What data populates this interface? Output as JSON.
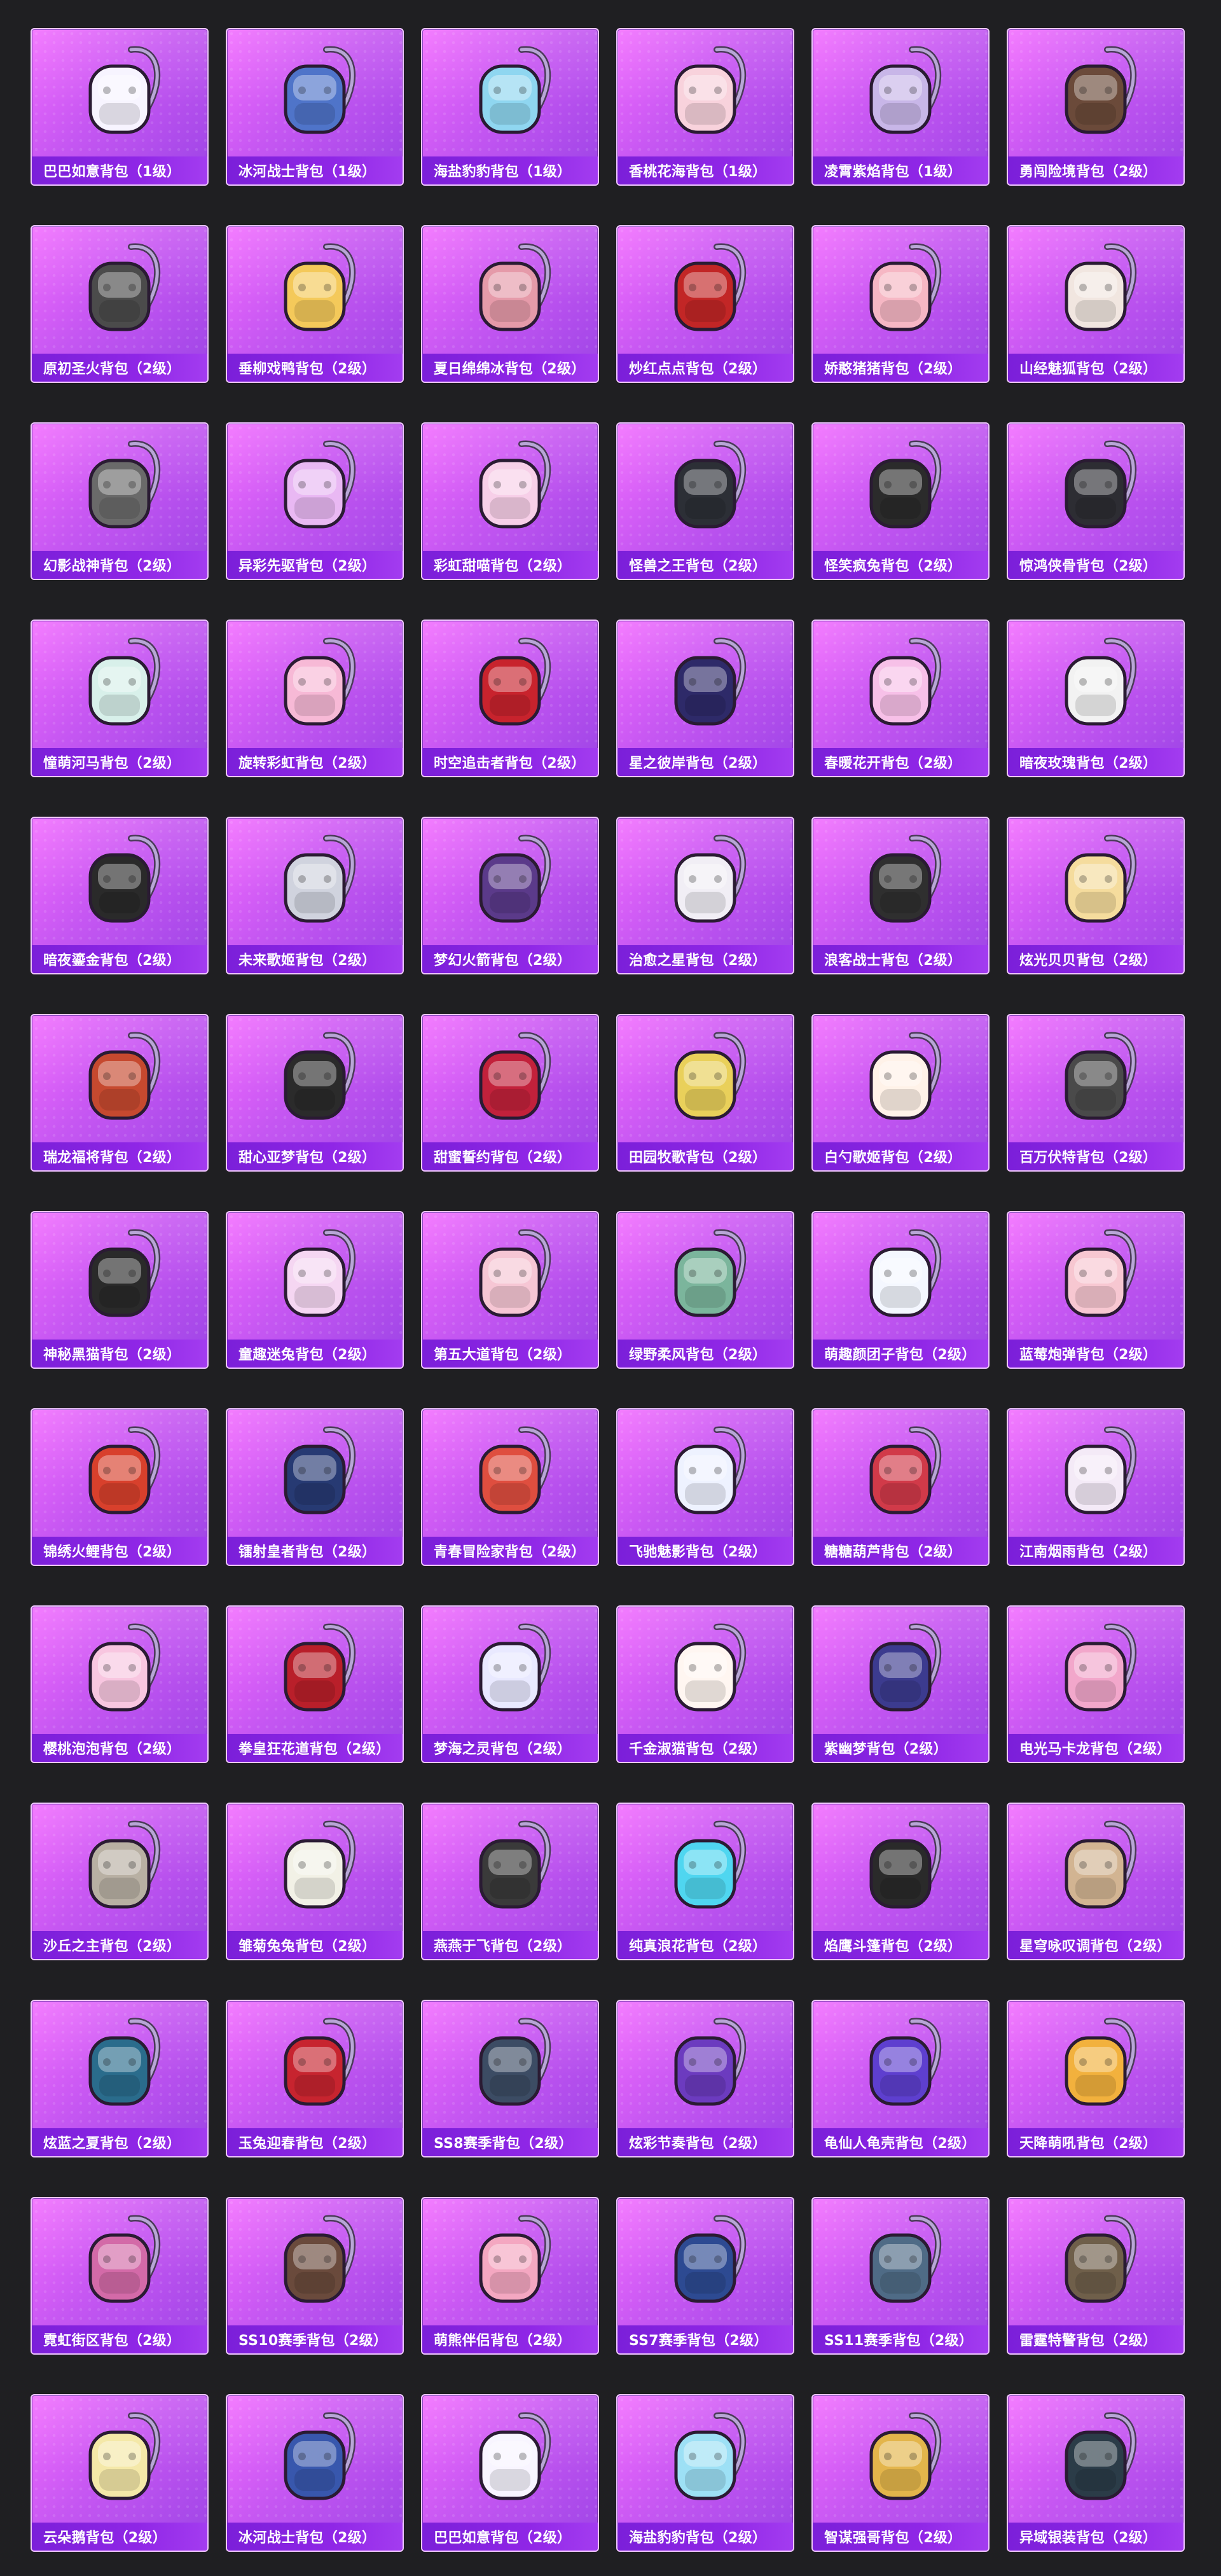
{
  "grid": {
    "items": [
      {
        "label": "巴巴如意背包（1级）",
        "icon": "backpack-icon",
        "color": "#f7f4ff"
      },
      {
        "label": "冰河战士背包（1级）",
        "icon": "backpack-icon",
        "color": "#4f74c9"
      },
      {
        "label": "海盐豹豹背包（1级）",
        "icon": "backpack-icon",
        "color": "#8fd6f0"
      },
      {
        "label": "香桃花海背包（1级）",
        "icon": "backpack-icon",
        "color": "#f8d2dc"
      },
      {
        "label": "凌霄紫焰背包（1级）",
        "icon": "backpack-icon",
        "color": "#c8b6e8"
      },
      {
        "label": "勇闯险境背包（2级）",
        "icon": "backpack-icon",
        "color": "#6b4a3a"
      },
      {
        "label": "原初圣火背包（2级）",
        "icon": "backpack-icon",
        "color": "#4b4b4b"
      },
      {
        "label": "垂柳戏鸭背包（2级）",
        "icon": "backpack-icon",
        "color": "#f4c95a"
      },
      {
        "label": "夏日绵绵冰背包（2级）",
        "icon": "backpack-icon",
        "color": "#e59aa9"
      },
      {
        "label": "炒红点点背包（2级）",
        "icon": "backpack-icon",
        "color": "#c22626"
      },
      {
        "label": "娇憨猪猪背包（2级）",
        "icon": "backpack-icon",
        "color": "#f6b7c4"
      },
      {
        "label": "山经魅狐背包（2级）",
        "icon": "backpack-icon",
        "color": "#f1e6e0"
      },
      {
        "label": "幻影战神背包（2级）",
        "icon": "backpack-icon",
        "color": "#6a6a6a"
      },
      {
        "label": "异彩先驱背包（2级）",
        "icon": "backpack-icon",
        "color": "#e9b8f3"
      },
      {
        "label": "彩虹甜喵背包（2级）",
        "icon": "backpack-icon",
        "color": "#f7cfe8"
      },
      {
        "label": "怪兽之王背包（2级）",
        "icon": "backpack-icon",
        "color": "#2c2f36"
      },
      {
        "label": "怪笑疯兔背包（2级）",
        "icon": "backpack-icon",
        "color": "#2b2b2b"
      },
      {
        "label": "惊鸿侠骨背包（2级）",
        "icon": "backpack-icon",
        "color": "#2d2d33"
      },
      {
        "label": "憧萌河马背包（2级）",
        "icon": "backpack-icon",
        "color": "#d8f0ea"
      },
      {
        "label": "旋转彩虹背包（2级）",
        "icon": "backpack-icon",
        "color": "#f7b9d6"
      },
      {
        "label": "时空追击者背包（2级）",
        "icon": "backpack-icon",
        "color": "#c8232d"
      },
      {
        "label": "星之彼岸背包（2级）",
        "icon": "backpack-icon",
        "color": "#2e2a69"
      },
      {
        "label": "春暖花开背包（2级）",
        "icon": "backpack-icon",
        "color": "#f7c0e8"
      },
      {
        "label": "暗夜玫瑰背包（2级）",
        "icon": "backpack-icon",
        "color": "#f2f2f2"
      },
      {
        "label": "暗夜鎏金背包（2级）",
        "icon": "backpack-icon",
        "color": "#2a2a2a"
      },
      {
        "label": "未来歌姬背包（2级）",
        "icon": "backpack-icon",
        "color": "#d0d3de"
      },
      {
        "label": "梦幻火箭背包（2级）",
        "icon": "backpack-icon",
        "color": "#5b3a8a"
      },
      {
        "label": "治愈之星背包（2级）",
        "icon": "backpack-icon",
        "color": "#f1eef5"
      },
      {
        "label": "浪客战士背包（2级）",
        "icon": "backpack-icon",
        "color": "#2f2f2f"
      },
      {
        "label": "炫光贝贝背包（2级）",
        "icon": "backpack-icon",
        "color": "#f5dc9d"
      },
      {
        "label": "瑞龙福将背包（2级）",
        "icon": "backpack-icon",
        "color": "#c6492f"
      },
      {
        "label": "甜心亚梦背包（2级）",
        "icon": "backpack-icon",
        "color": "#2b2b2b"
      },
      {
        "label": "甜蜜誓约背包（2级）",
        "icon": "backpack-icon",
        "color": "#c2213b"
      },
      {
        "label": "田园牧歌背包（2级）",
        "icon": "backpack-icon",
        "color": "#e9d05a"
      },
      {
        "label": "白勺歌姬背包（2级）",
        "icon": "backpack-icon",
        "color": "#fff2e8"
      },
      {
        "label": "百万伏特背包（2级）",
        "icon": "backpack-icon",
        "color": "#4a4a4a"
      },
      {
        "label": "神秘黑猫背包（2级）",
        "icon": "backpack-icon",
        "color": "#2a2a2a"
      },
      {
        "label": "童趣迷兔背包（2级）",
        "icon": "backpack-icon",
        "color": "#f5d6f2"
      },
      {
        "label": "第五大道背包（2级）",
        "icon": "backpack-icon",
        "color": "#f6c6d4"
      },
      {
        "label": "绿野柔风背包（2级）",
        "icon": "backpack-icon",
        "color": "#7bb59c"
      },
      {
        "label": "萌趣颜团子背包（2级）",
        "icon": "backpack-icon",
        "color": "#f4f7ff"
      },
      {
        "label": "蓝莓炮弹背包（2级）",
        "icon": "backpack-icon",
        "color": "#f7c7d1"
      },
      {
        "label": "锦绣火鲤背包（2级）",
        "icon": "backpack-icon",
        "color": "#d8402c"
      },
      {
        "label": "镭射皇者背包（2级）",
        "icon": "backpack-icon",
        "color": "#273a73"
      },
      {
        "label": "青春冒险家背包（2级）",
        "icon": "backpack-icon",
        "color": "#df4e3f"
      },
      {
        "label": "飞驰魅影背包（2级）",
        "icon": "backpack-icon",
        "color": "#eef2ff"
      },
      {
        "label": "糖糖葫芦背包（2级）",
        "icon": "backpack-icon",
        "color": "#d13a49"
      },
      {
        "label": "江南烟雨背包（2级）",
        "icon": "backpack-icon",
        "color": "#f4eaf7"
      },
      {
        "label": "樱桃泡泡背包（2级）",
        "icon": "backpack-icon",
        "color": "#f8c6e0"
      },
      {
        "label": "拳皇狂花道背包（2级）",
        "icon": "backpack-icon",
        "color": "#b91f2a"
      },
      {
        "label": "梦海之灵背包（2级）",
        "icon": "backpack-icon",
        "color": "#e9e9ff"
      },
      {
        "label": "千金淑猫背包（2级）",
        "icon": "backpack-icon",
        "color": "#fff6f1"
      },
      {
        "label": "紫幽梦背包（2级）",
        "icon": "backpack-icon",
        "color": "#3c3b8f"
      },
      {
        "label": "电光马卡龙背包（2级）",
        "icon": "backpack-icon",
        "color": "#f2a7cb"
      },
      {
        "label": "沙丘之主背包（2级）",
        "icon": "backpack-icon",
        "color": "#b8b0a3"
      },
      {
        "label": "雏菊兔兔背包（2级）",
        "icon": "backpack-icon",
        "color": "#f2f1e6"
      },
      {
        "label": "燕燕于飞背包（2级）",
        "icon": "backpack-icon",
        "color": "#3a3a3a"
      },
      {
        "label": "纯真浪花背包（2级）",
        "icon": "backpack-icon",
        "color": "#4fd6f0"
      },
      {
        "label": "焰鹰斗篷背包（2级）",
        "icon": "backpack-icon",
        "color": "#2a2a2a"
      },
      {
        "label": "星穹咏叹调背包（2级）",
        "icon": "backpack-icon",
        "color": "#d2b492"
      },
      {
        "label": "炫蓝之夏背包（2级）",
        "icon": "backpack-icon",
        "color": "#2a6c8c"
      },
      {
        "label": "玉兔迎春背包（2级）",
        "icon": "backpack-icon",
        "color": "#c7242f"
      },
      {
        "label": "SS8赛季背包（2级）",
        "icon": "backpack-icon",
        "color": "#3c4c64"
      },
      {
        "label": "炫彩节奏背包（2级）",
        "icon": "backpack-icon",
        "color": "#6c3bbf"
      },
      {
        "label": "龟仙人龟壳背包（2级）",
        "icon": "backpack-icon",
        "color": "#5e3fcf"
      },
      {
        "label": "天降萌吼背包（2级）",
        "icon": "backpack-icon",
        "color": "#f2b13d"
      },
      {
        "label": "霓虹街区背包（2级）",
        "icon": "backpack-icon",
        "color": "#d36aa8"
      },
      {
        "label": "SS10赛季背包（2级）",
        "icon": "backpack-icon",
        "color": "#6a4a3c"
      },
      {
        "label": "萌熊伴侣背包（2级）",
        "icon": "backpack-icon",
        "color": "#f4a7c1"
      },
      {
        "label": "SS7赛季背包（2级）",
        "icon": "backpack-icon",
        "color": "#2d4a92"
      },
      {
        "label": "SS11赛季背包（2级）",
        "icon": "backpack-icon",
        "color": "#4f6b86"
      },
      {
        "label": "雷霆特警背包（2级）",
        "icon": "backpack-icon",
        "color": "#6f5f4a"
      },
      {
        "label": "云朵鹅背包（2级）",
        "icon": "backpack-icon",
        "color": "#f4e8a8"
      },
      {
        "label": "冰河战士背包（2级）",
        "icon": "backpack-icon",
        "color": "#3857ad"
      },
      {
        "label": "巴巴如意背包（2级）",
        "icon": "backpack-icon",
        "color": "#f8f5ff"
      },
      {
        "label": "海盐豹豹背包（2级）",
        "icon": "backpack-icon",
        "color": "#9de0f5"
      },
      {
        "label": "智谋强哥背包（2级）",
        "icon": "backpack-icon",
        "color": "#e3b54b"
      },
      {
        "label": "异域银装背包（2级）",
        "icon": "backpack-icon",
        "color": "#2b3c48"
      }
    ]
  }
}
